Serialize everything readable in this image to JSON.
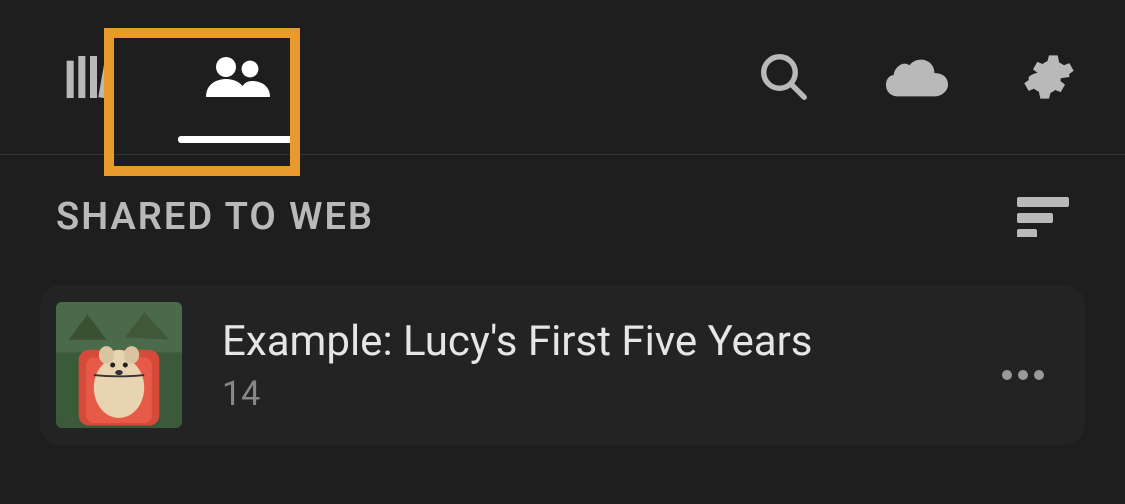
{
  "section": {
    "title": "SHARED TO WEB"
  },
  "albums": [
    {
      "title": "Example: Lucy's First Five Years",
      "count": "14"
    }
  ],
  "icons": {
    "library": "library-icon",
    "people": "people-icon",
    "search": "search-icon",
    "cloud": "cloud-icon",
    "gear": "gear-icon",
    "sort": "sort-icon",
    "more": "more-icon"
  },
  "colors": {
    "highlight": "#e89a2c",
    "bg": "#1e1e1e",
    "row": "#232323"
  }
}
